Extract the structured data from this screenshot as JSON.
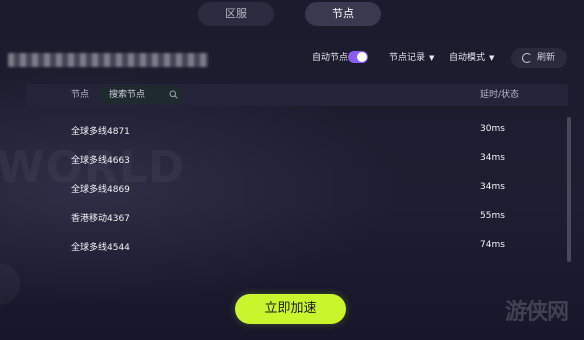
{
  "tabs": [
    {
      "label": "区服",
      "active": false
    },
    {
      "label": "节点",
      "active": true
    }
  ],
  "controls": {
    "auto_node_label": "自动节点",
    "auto_node_on": true,
    "node_record_label": "节点记录",
    "auto_mode_label": "自动模式",
    "refresh_label": "刷新"
  },
  "table": {
    "col_node": "节点",
    "search_placeholder": "搜索节点",
    "col_latency": "延时/状态",
    "rows": [
      {
        "name": "全球多线4871",
        "latency": "30ms"
      },
      {
        "name": "全球多线4663",
        "latency": "34ms"
      },
      {
        "name": "全球多线4869",
        "latency": "34ms"
      },
      {
        "name": "香港移动4367",
        "latency": "55ms"
      },
      {
        "name": "全球多线4544",
        "latency": "74ms"
      }
    ]
  },
  "accelerate_button": "立即加速",
  "watermark": "游侠网",
  "colors": {
    "background": "#1b1a2e",
    "accent_toggle": "#8a5cf6",
    "accelerate": "#c8f52c"
  }
}
